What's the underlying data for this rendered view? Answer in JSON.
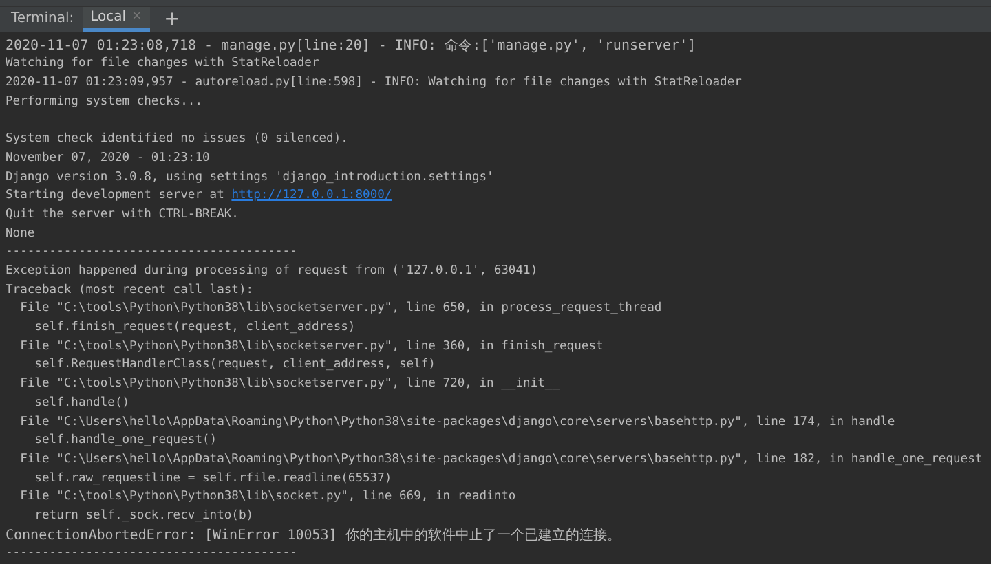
{
  "tool_window": {
    "title": "Terminal:",
    "tabs": [
      {
        "label": "Local",
        "selected": true,
        "close": "×"
      }
    ],
    "add_button": "+"
  },
  "lines": [
    {
      "kind": "text",
      "text": "2020-11-07 01:23:08,718 - manage.py[line:20] - INFO: 命令:['manage.py', 'runserver']"
    },
    {
      "kind": "text",
      "text": "Watching for file changes with StatReloader"
    },
    {
      "kind": "text",
      "text": "2020-11-07 01:23:09,957 - autoreload.py[line:598] - INFO: Watching for file changes with StatReloader"
    },
    {
      "kind": "text",
      "text": "Performing system checks..."
    },
    {
      "kind": "blank"
    },
    {
      "kind": "text",
      "text": "System check identified no issues (0 silenced)."
    },
    {
      "kind": "text",
      "text": "November 07, 2020 - 01:23:10"
    },
    {
      "kind": "text",
      "text": "Django version 3.0.8, using settings 'django_introduction.settings'"
    },
    {
      "kind": "link",
      "text": "Starting development server at ",
      "link": "http://127.0.0.1:8000/"
    },
    {
      "kind": "text",
      "text": "Quit the server with CTRL-BREAK."
    },
    {
      "kind": "text",
      "text": "None"
    },
    {
      "kind": "text",
      "text": "----------------------------------------"
    },
    {
      "kind": "text",
      "text": "Exception happened during processing of request from ('127.0.0.1', 63041)"
    },
    {
      "kind": "text",
      "text": "Traceback (most recent call last):"
    },
    {
      "kind": "text",
      "text": "  File \"C:\\tools\\Python\\Python38\\lib\\socketserver.py\", line 650, in process_request_thread"
    },
    {
      "kind": "text",
      "text": "    self.finish_request(request, client_address)"
    },
    {
      "kind": "text",
      "text": "  File \"C:\\tools\\Python\\Python38\\lib\\socketserver.py\", line 360, in finish_request"
    },
    {
      "kind": "text",
      "text": "    self.RequestHandlerClass(request, client_address, self)"
    },
    {
      "kind": "text",
      "text": "  File \"C:\\tools\\Python\\Python38\\lib\\socketserver.py\", line 720, in __init__"
    },
    {
      "kind": "text",
      "text": "    self.handle()"
    },
    {
      "kind": "text",
      "text": "  File \"C:\\Users\\hello\\AppData\\Roaming\\Python\\Python38\\site-packages\\django\\core\\servers\\basehttp.py\", line 174, in handle"
    },
    {
      "kind": "text",
      "text": "    self.handle_one_request()"
    },
    {
      "kind": "text",
      "text": "  File \"C:\\Users\\hello\\AppData\\Roaming\\Python\\Python38\\site-packages\\django\\core\\servers\\basehttp.py\", line 182, in handle_one_request"
    },
    {
      "kind": "text",
      "text": "    self.raw_requestline = self.rfile.readline(65537)"
    },
    {
      "kind": "text",
      "text": "  File \"C:\\tools\\Python\\Python38\\lib\\socket.py\", line 669, in readinto"
    },
    {
      "kind": "text",
      "text": "    return self._sock.recv_into(b)"
    },
    {
      "kind": "text",
      "text": "ConnectionAbortedError: [WinError 10053] 你的主机中的软件中止了一个已建立的连接。"
    },
    {
      "kind": "text",
      "text": "----------------------------------------"
    }
  ]
}
